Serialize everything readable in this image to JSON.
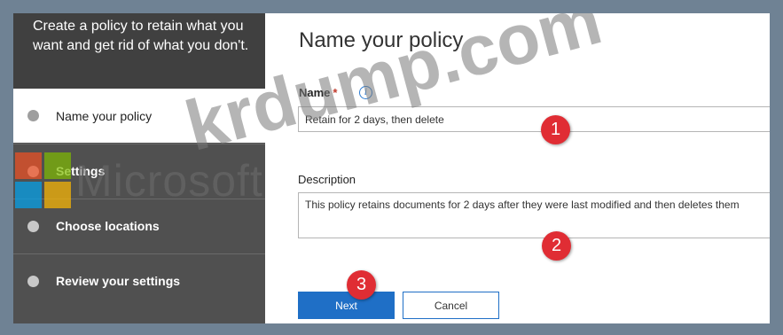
{
  "sidebar": {
    "intro": "Create a policy to retain what you want and get rid of what you don't.",
    "steps": [
      {
        "label": "Name your policy"
      },
      {
        "label": "Settings"
      },
      {
        "label": "Choose locations"
      },
      {
        "label": "Review your settings"
      }
    ]
  },
  "main": {
    "title": "Name your policy",
    "name_label": "Name",
    "required_mark": "*",
    "info_icon": "i",
    "name_value": "Retain for 2 days, then delete",
    "description_label": "Description",
    "description_value": "This policy retains documents for 2 days after they were last modified and then deletes them",
    "next_label": "Next",
    "cancel_label": "Cancel"
  },
  "markers": [
    "1",
    "2",
    "3"
  ],
  "watermark": {
    "microsoft": "Microsoft",
    "site": "krdump.com",
    "logo_colors": [
      "#f25022",
      "#7fba00",
      "#00a4ef",
      "#ffb900"
    ]
  },
  "colors": {
    "accent": "#1f6fc6",
    "marker": "#e02d34",
    "sidebar": "#505050"
  }
}
